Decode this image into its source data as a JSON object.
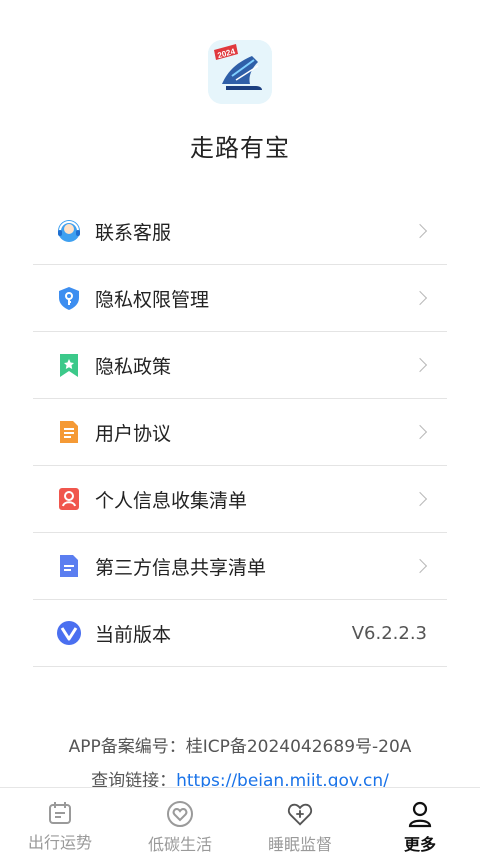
{
  "app": {
    "name": "走路有宝",
    "logo_badge": "2024"
  },
  "menu": {
    "items": [
      {
        "label": "联系客服",
        "icon": "customer-service-icon"
      },
      {
        "label": "隐私权限管理",
        "icon": "shield-key-icon"
      },
      {
        "label": "隐私政策",
        "icon": "bookmark-star-icon"
      },
      {
        "label": "用户协议",
        "icon": "document-icon"
      },
      {
        "label": "个人信息收集清单",
        "icon": "person-card-icon"
      },
      {
        "label": "第三方信息共享清单",
        "icon": "file-list-icon"
      },
      {
        "label": "当前版本",
        "icon": "version-v-icon",
        "value": "V6.2.2.3"
      }
    ]
  },
  "footer": {
    "record": "APP备案编号：桂ICP备2024042689号-20A",
    "query_label": "查询链接：",
    "query_url": "https://beian.miit.gov.cn/"
  },
  "tabbar": {
    "tabs": [
      {
        "label": "出行运势",
        "icon": "calendar-icon",
        "active": false
      },
      {
        "label": "低碳生活",
        "icon": "heart-circle-icon",
        "active": false
      },
      {
        "label": "睡眠监督",
        "icon": "heart-plus-icon",
        "active": false
      },
      {
        "label": "更多",
        "icon": "person-icon",
        "active": true
      }
    ]
  },
  "colors": {
    "accent_blue": "#1a73e8",
    "divider": "#e4e4e4",
    "inactive_tab": "#9a9a9a"
  }
}
